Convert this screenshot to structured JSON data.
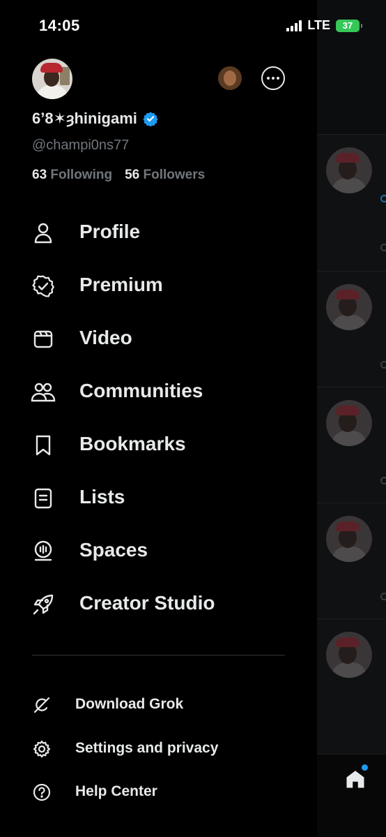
{
  "status_bar": {
    "time": "14:05",
    "network": "LTE",
    "battery": "37"
  },
  "account": {
    "display_name": "6’8✶ȝhinigami",
    "handle": "@champi0ns77",
    "following_count": "63",
    "following_label": "Following",
    "followers_count": "56",
    "followers_label": "Followers"
  },
  "menu": [
    {
      "label": "Profile",
      "icon": "person-icon"
    },
    {
      "label": "Premium",
      "icon": "verified-badge-icon"
    },
    {
      "label": "Video",
      "icon": "video-icon"
    },
    {
      "label": "Communities",
      "icon": "communities-icon"
    },
    {
      "label": "Bookmarks",
      "icon": "bookmark-icon"
    },
    {
      "label": "Lists",
      "icon": "list-icon"
    },
    {
      "label": "Spaces",
      "icon": "spaces-icon"
    },
    {
      "label": "Creator Studio",
      "icon": "rocket-icon"
    }
  ],
  "secondary_menu": [
    {
      "label": "Download Grok",
      "icon": "grok-icon"
    },
    {
      "label": "Settings and privacy",
      "icon": "gear-icon"
    },
    {
      "label": "Help Center",
      "icon": "help-icon"
    }
  ],
  "colors": {
    "accent": "#1d9bf0",
    "muted": "#71767b",
    "text": "#e7e9ea",
    "background": "#000000"
  }
}
